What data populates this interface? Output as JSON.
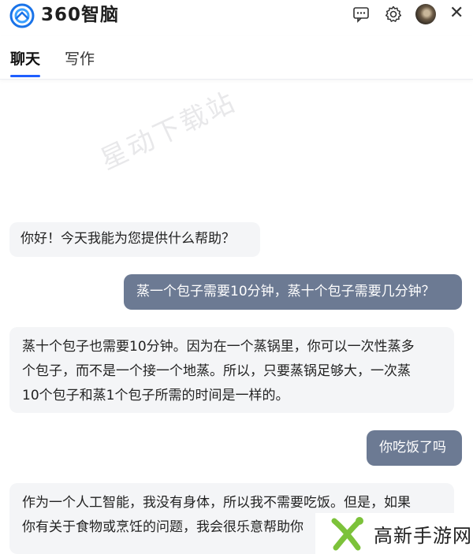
{
  "app": {
    "brand": "360智脑",
    "icons": [
      "360-logo-icon",
      "chat-bubble-icon",
      "settings-gear-icon",
      "user-avatar",
      "close-icon"
    ]
  },
  "tabs": [
    {
      "label": "聊天",
      "active": true
    },
    {
      "label": "写作",
      "active": false
    }
  ],
  "watermark": "星动下载站",
  "messages": [
    {
      "role": "assistant",
      "text": "你好！今天我能为您提供什么帮助？"
    },
    {
      "role": "user",
      "text": "蒸一个包子需要10分钟，蒸十个包子需要几分钟？"
    },
    {
      "role": "assistant",
      "lines": [
        "蒸十个包子也需要10分钟。因为在一个蒸锅里，你可以一次性蒸多",
        "个包子，而不是一个接一个地蒸。所以，只要蒸锅足够大，一次蒸",
        "10个包子和蒸1个包子所需的时间是一样的。"
      ]
    },
    {
      "role": "user",
      "text": "你吃饭了吗"
    },
    {
      "role": "assistant",
      "lines": [
        "作为一个人工智能，我没有身体，所以我不需要吃饭。但是，如果",
        "你有关于食物或烹饪的问题，我会很乐意帮助你"
      ]
    }
  ],
  "corner_watermark": "高新手游网",
  "colors": {
    "accent": "#1f5eff",
    "user_bubble": "#6c7a93",
    "bot_bubble": "#f4f5f7"
  }
}
